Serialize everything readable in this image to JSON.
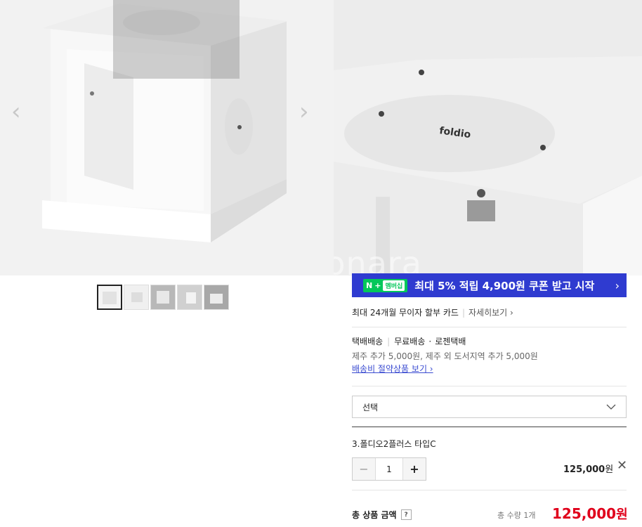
{
  "gallery": {
    "prev_icon": "chevron-left-icon",
    "next_icon": "chevron-right-icon",
    "watermark": "Joonggonara",
    "thumbnails": [
      "thumb-1",
      "thumb-2",
      "thumb-3",
      "thumb-4",
      "thumb-5"
    ]
  },
  "promo": {
    "badge_n": "N",
    "badge_plus": "+",
    "badge_member": "멤버십",
    "text": "최대 5% 적립 4,900원 쿠폰 받고 시작",
    "chevron": "›"
  },
  "card": {
    "text": "최대 24개월 무이자 할부 카드",
    "link": "자세히보기 ›"
  },
  "shipping": {
    "type": "택배배송",
    "fee": "무료배송",
    "courier": "로젠택배",
    "extra": "제주 추가 5,000원, 제주 외 도서지역 추가 5,000원",
    "link": "배송비 절약상품 보기 ›"
  },
  "select": {
    "value": "선택",
    "icon": "chevron-down-icon"
  },
  "option": {
    "name": "3.폴디오2플러스 타입C",
    "qty": "1",
    "minus": "−",
    "plus": "+",
    "price": "125,000",
    "unit": "원",
    "remove": "✕"
  },
  "total": {
    "label": "총 상품 금액",
    "help": "?",
    "count": "총 수량 1개",
    "price": "125,000",
    "unit": "원"
  },
  "colors": {
    "promo_bg": "#2f3bd0",
    "naver_green": "#03c75a",
    "price_red": "#e0001b",
    "link_blue": "#3a4bd1"
  }
}
